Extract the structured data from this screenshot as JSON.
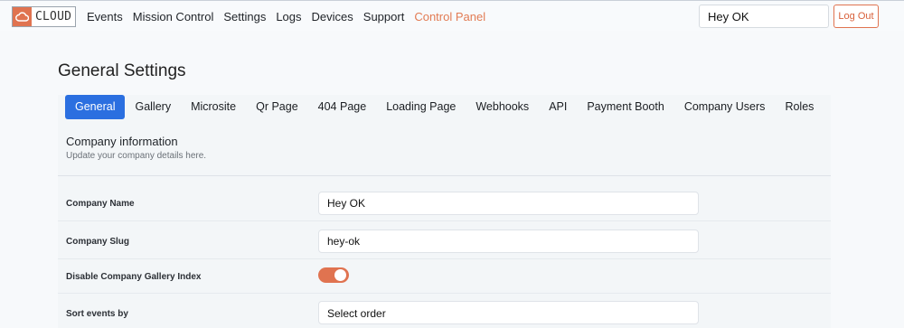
{
  "header": {
    "logo_text": "CLOUD",
    "nav": [
      "Events",
      "Mission Control",
      "Settings",
      "Logs",
      "Devices",
      "Support",
      "Control Panel"
    ],
    "company_value": "Hey OK",
    "logout_label": "Log Out",
    "accent_color": "#e07350"
  },
  "page": {
    "title": "General Settings",
    "tabs": [
      "General",
      "Gallery",
      "Microsite",
      "Qr Page",
      "404 Page",
      "Loading Page",
      "Webhooks",
      "API",
      "Payment Booth",
      "Company Users",
      "Roles"
    ],
    "active_tab": "General",
    "section": {
      "title": "Company information",
      "subtitle": "Update your company details here."
    },
    "fields": {
      "company_name": {
        "label": "Company Name",
        "value": "Hey OK"
      },
      "company_slug": {
        "label": "Company Slug",
        "value": "hey-ok"
      },
      "disable_gallery_index": {
        "label": "Disable Company Gallery Index",
        "value": true
      },
      "sort_events": {
        "label": "Sort events by",
        "value": "Select order"
      }
    }
  }
}
